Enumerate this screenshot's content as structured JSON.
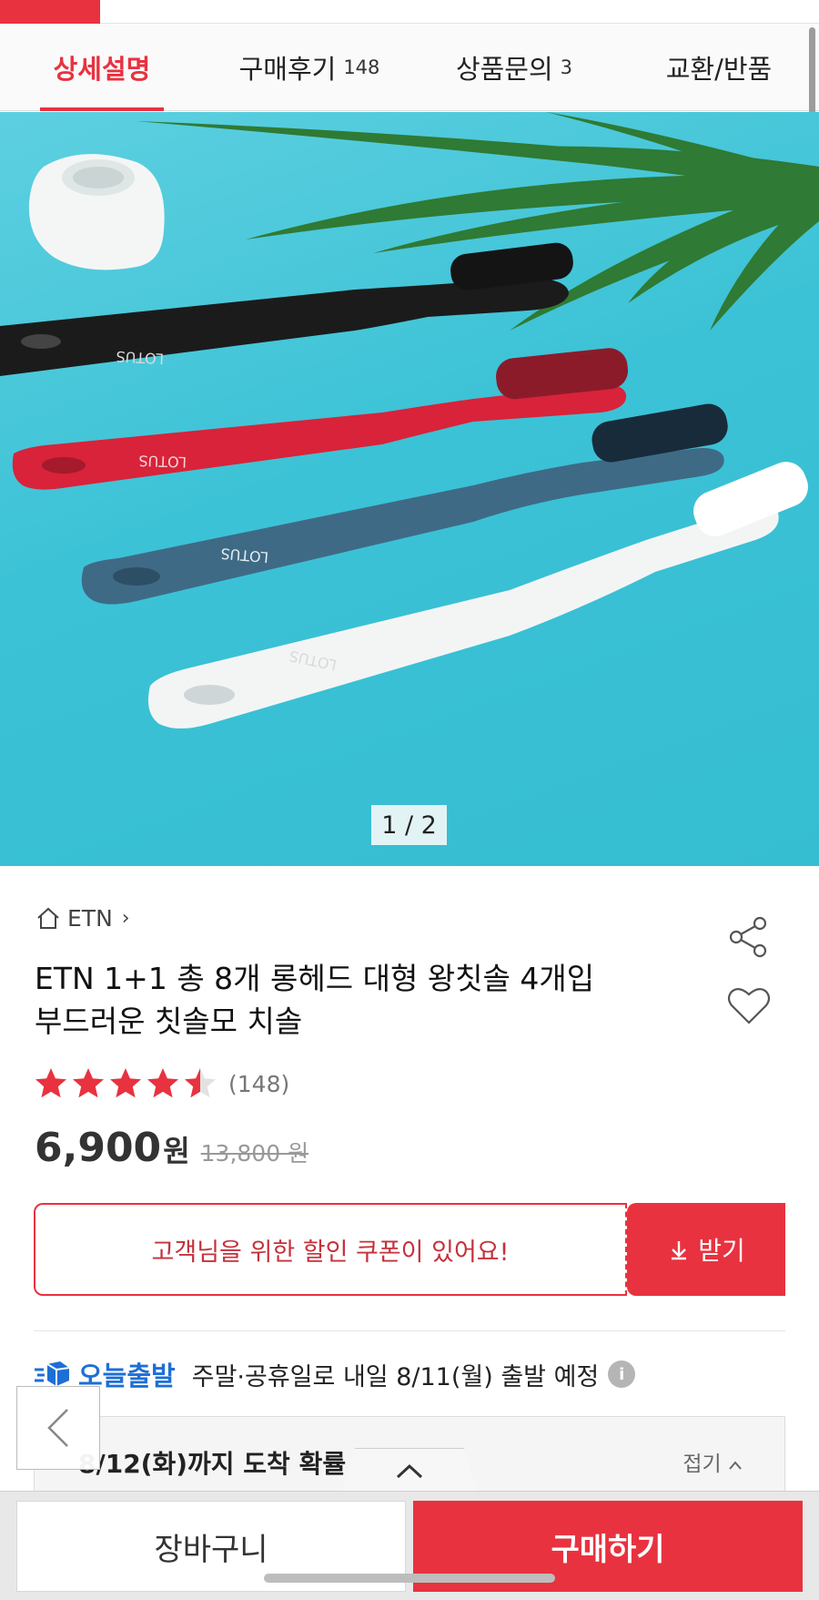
{
  "tabs": [
    {
      "label": "상세설명",
      "count": ""
    },
    {
      "label": "구매후기",
      "count": "148"
    },
    {
      "label": "상품문의",
      "count": "3"
    },
    {
      "label": "교환/반품",
      "count": ""
    }
  ],
  "gallery": {
    "indicator": "1 / 2",
    "image_labels": [
      "LOTUS",
      "LOTUS",
      "LOTUS",
      "LOTUS"
    ]
  },
  "product": {
    "brand": "ETN",
    "title_line1": "ETN 1+1 총 8개 롱헤드 대형 왕칫솔 4개입",
    "title_line2": "부드러운 칫솔모 치솔",
    "rating": 4.5,
    "review_count": "(148)",
    "price": "6,900",
    "currency": "원",
    "original_price": "13,800 원"
  },
  "coupon": {
    "message": "고객님을 위한 할인 쿠폰이 있어요!",
    "button": "받기"
  },
  "shipping": {
    "badge": "오늘출발",
    "text": "주말·공휴일로 내일 8/11(월) 출발 예정",
    "info_icon": "i"
  },
  "arrival": {
    "text": "8/12(화)까지 도착 확률",
    "fold": "접기"
  },
  "bottom": {
    "cart": "장바구니",
    "buy": "구매하기"
  },
  "colors": {
    "accent": "#e8323f",
    "ship_blue": "#1d6fd6",
    "hero_bg": "#3cc2d6"
  }
}
